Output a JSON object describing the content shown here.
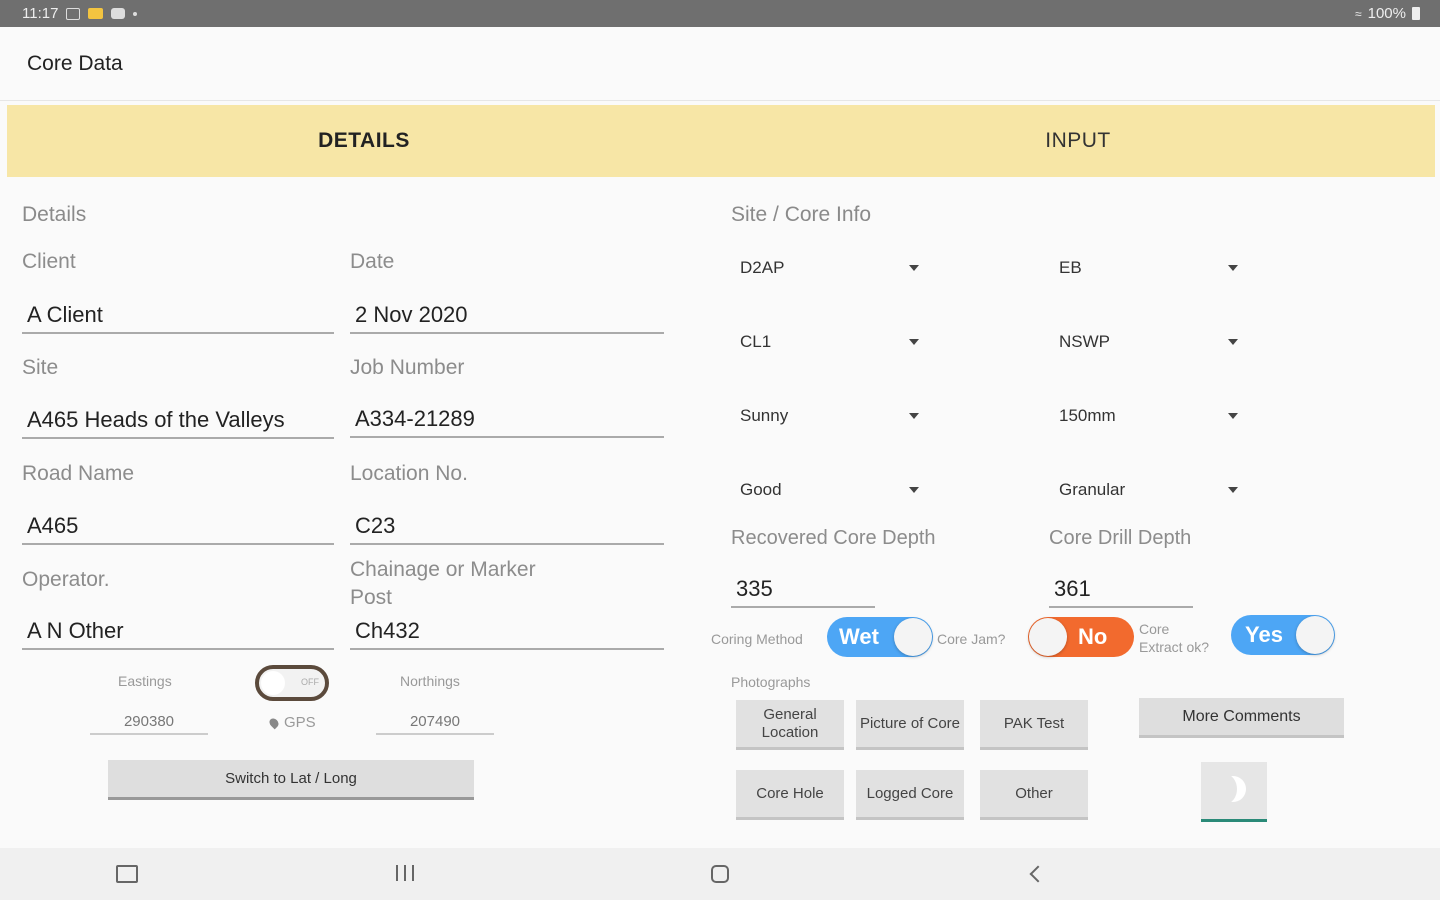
{
  "status_bar": {
    "time": "11:17",
    "battery": "100%"
  },
  "app": {
    "title": "Core Data"
  },
  "tabs": [
    {
      "label": "DETAILS"
    },
    {
      "label": "INPUT"
    }
  ],
  "details": {
    "section_title": "Details",
    "client": {
      "label": "Client",
      "value": "A Client"
    },
    "date": {
      "label": "Date",
      "value": "2 Nov 2020"
    },
    "site": {
      "label": "Site",
      "value": "A465 Heads of the Valleys"
    },
    "job_number": {
      "label": "Job Number",
      "value": "A334-21289"
    },
    "road_name": {
      "label": "Road Name",
      "value": "A465"
    },
    "location_no": {
      "label": "Location No.",
      "value": "C23"
    },
    "operator": {
      "label": "Operator.",
      "value": "A N Other"
    },
    "chainage": {
      "label_line1": "Chainage or Marker",
      "label_line2": "Post",
      "value": "Ch432"
    },
    "eastings": {
      "label": "Eastings",
      "value": "290380"
    },
    "northings": {
      "label": "Northings",
      "value": "207490"
    },
    "gps_toggle": {
      "label": "OFF"
    },
    "gps_label": "GPS",
    "switch_button": "Switch to Lat / Long"
  },
  "site_core": {
    "section_title": "Site / Core Info",
    "dropdowns": {
      "r1_left": "D2AP",
      "r1_right": "EB",
      "r2_left": "CL1",
      "r2_right": "NSWP",
      "r3_left": "Sunny",
      "r3_right": "150mm",
      "r4_left": "Good",
      "r4_right": "Granular"
    },
    "recovered_depth": {
      "label": "Recovered Core Depth",
      "value": "335"
    },
    "drill_depth": {
      "label": "Core Drill Depth",
      "value": "361"
    },
    "coring_method": {
      "label": "Coring Method",
      "value": "Wet"
    },
    "core_jam": {
      "label": "Core Jam?",
      "value": "No"
    },
    "core_extract": {
      "label_line1": "Core",
      "label_line2": "Extract ok?",
      "value": "Yes"
    },
    "photographs_label": "Photographs",
    "photo_buttons": {
      "general_location": "General Location",
      "picture_of_core": "Picture of Core",
      "pak_test": "PAK Test",
      "core_hole": "Core Hole",
      "logged_core": "Logged Core",
      "other": "Other"
    },
    "more_comments": "More Comments"
  },
  "colors": {
    "tab_bg": "#f7e6a6",
    "pill_blue": "#4da6f5",
    "pill_orange": "#f26a2e",
    "accent_teal": "#2a8a78"
  }
}
